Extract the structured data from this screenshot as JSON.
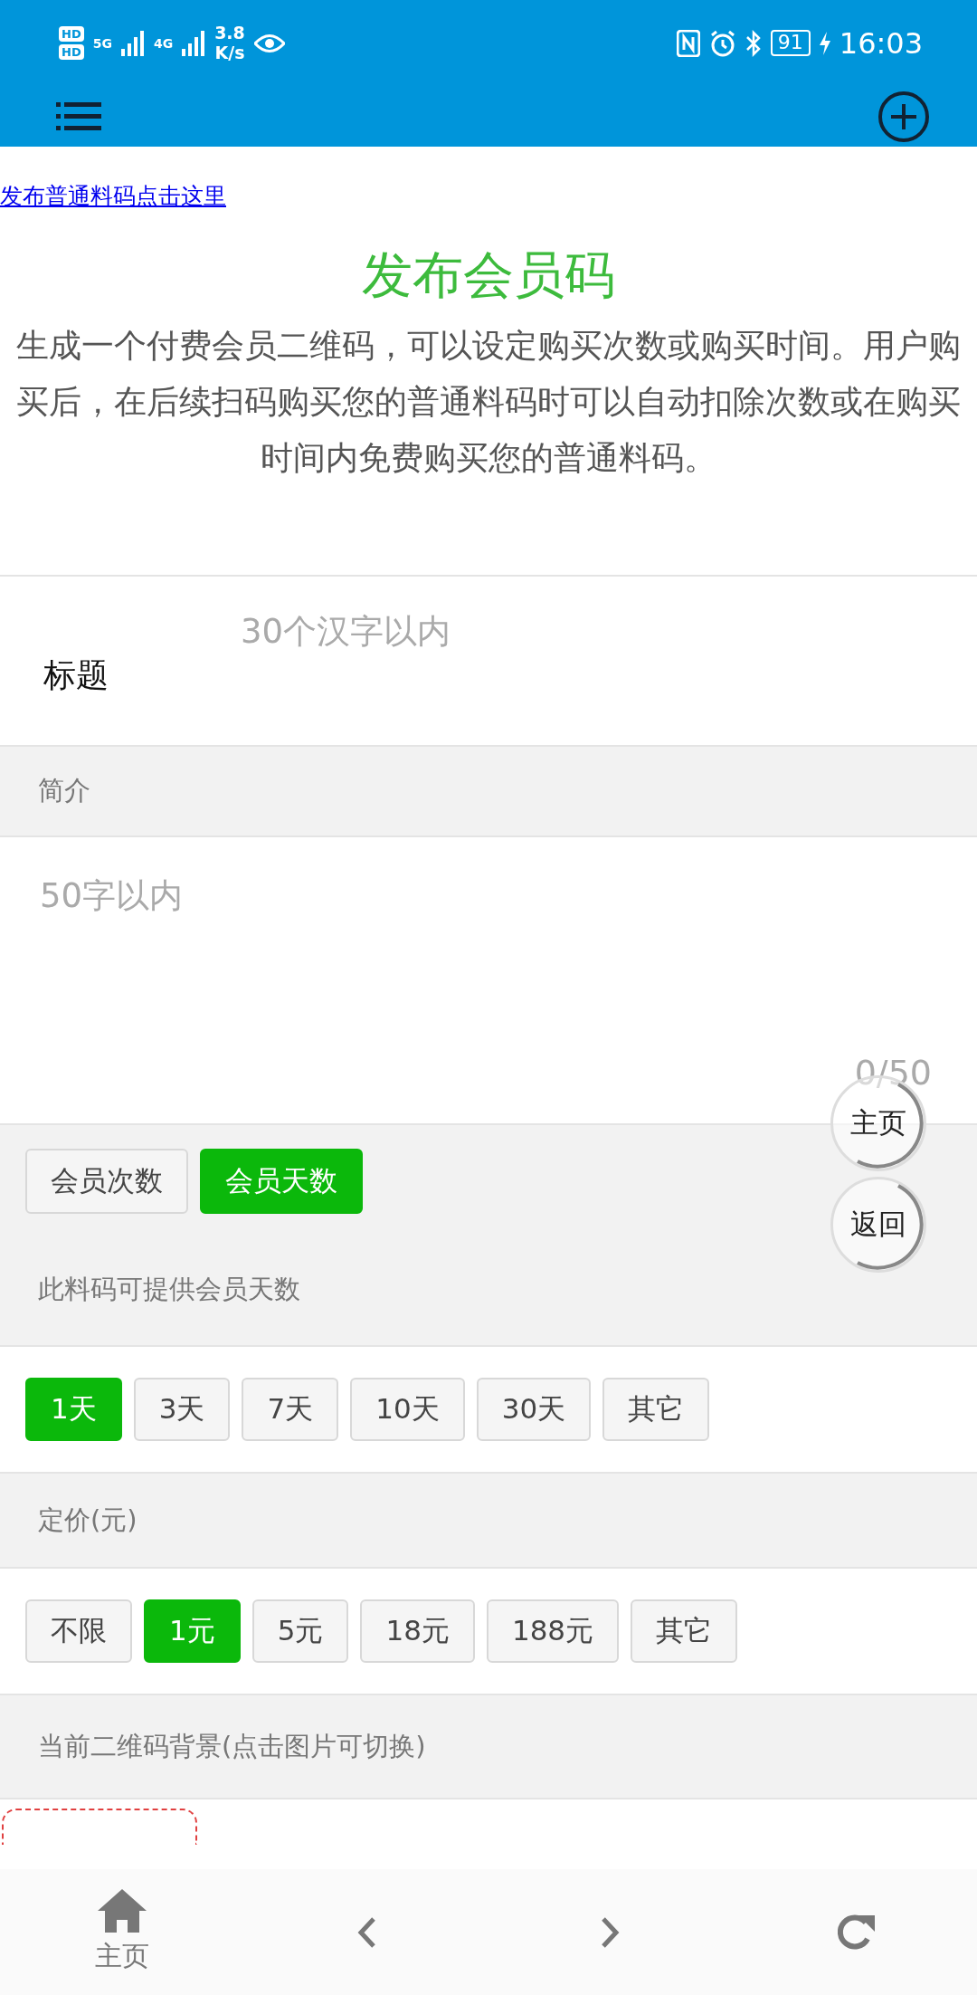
{
  "status_bar": {
    "sim_labels": [
      "HD",
      "HD"
    ],
    "networks": [
      "5G",
      "4G"
    ],
    "speed_value": "3.8",
    "speed_unit": "K/s",
    "battery": "91",
    "time": "16:03"
  },
  "publish_link": "发布普通料码点击这里",
  "heading": "发布会员码",
  "description": "生成一个付费会员二维码，可以设定购买次数或购买时间。用户购买后，在后续扫码购买您的普通料码时可以自动扣除次数或在购买时间内免费购买您的普通料码。",
  "title_field": {
    "label": "标题",
    "placeholder": "30个汉字以内"
  },
  "intro": {
    "label": "简介",
    "placeholder": "50字以内",
    "counter": "0/50"
  },
  "member_types": [
    {
      "label": "会员次数",
      "selected": false
    },
    {
      "label": "会员天数",
      "selected": true
    }
  ],
  "days": {
    "label": "此料码可提供会员天数",
    "options": [
      {
        "label": "1天",
        "selected": true
      },
      {
        "label": "3天",
        "selected": false
      },
      {
        "label": "7天",
        "selected": false
      },
      {
        "label": "10天",
        "selected": false
      },
      {
        "label": "30天",
        "selected": false
      },
      {
        "label": "其它",
        "selected": false
      }
    ]
  },
  "price": {
    "label": "定价(元)",
    "options": [
      {
        "label": "不限",
        "selected": false
      },
      {
        "label": "1元",
        "selected": true
      },
      {
        "label": "5元",
        "selected": false
      },
      {
        "label": "18元",
        "selected": false
      },
      {
        "label": "188元",
        "selected": false
      },
      {
        "label": "其它",
        "selected": false
      }
    ]
  },
  "background": {
    "label": "当前二维码背景(点击图片可切换)"
  },
  "floating_buttons": [
    "主页",
    "返回"
  ],
  "bottom_nav": {
    "home_label": "主页"
  }
}
